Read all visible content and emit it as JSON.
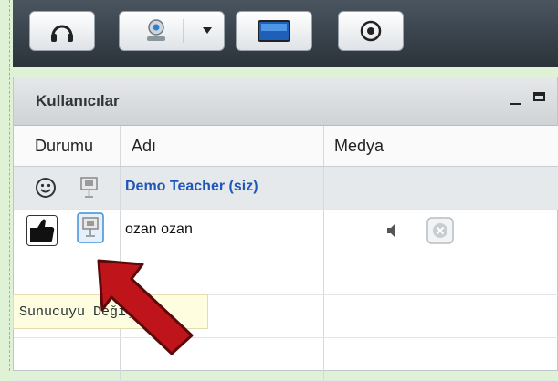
{
  "panel": {
    "title": "Kullanıcılar"
  },
  "columns": {
    "status": "Durumu",
    "name": "Adı",
    "media": "Medya"
  },
  "users": [
    {
      "name": "Demo Teacher (siz)",
      "status_icon": "smiley-icon",
      "role_icon": "presenter-icon",
      "is_me": true
    },
    {
      "name": "ozan ozan",
      "status_icon": "thumbs-up-icon",
      "role_icon": "presenter-icon",
      "is_me": false,
      "media": [
        "speaker-icon",
        "mute-button-icon"
      ]
    }
  ],
  "tooltip": {
    "text": "Sunucuyu Değiştir"
  },
  "toolbar": {
    "buttons": [
      "headset-icon",
      "webcam-icon",
      "screen-share-icon",
      "record-icon"
    ]
  },
  "colors": {
    "toolbar": "#2b333a",
    "accent_name": "#1f57b8",
    "arrow": "#c0141b",
    "tooltip_bg": "#fffde0"
  }
}
